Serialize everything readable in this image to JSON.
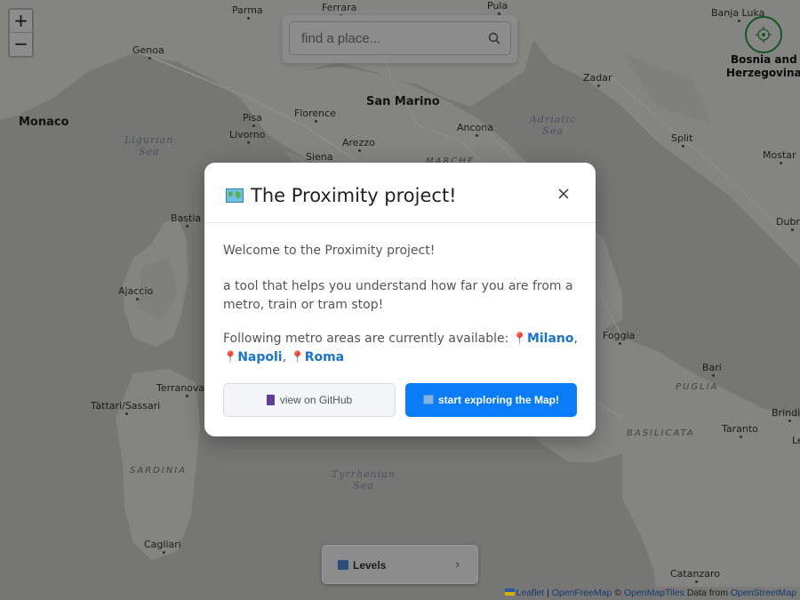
{
  "map": {
    "cities": [
      {
        "id": "parma",
        "label": "Parma"
      },
      {
        "id": "ferrara",
        "label": "Ferrara"
      },
      {
        "id": "pula",
        "label": "Pula"
      },
      {
        "id": "banja-luka",
        "label": "Banja Luka"
      },
      {
        "id": "genoa",
        "label": "Genoa"
      },
      {
        "id": "zadar",
        "label": "Zadar"
      },
      {
        "id": "monaco",
        "label": "Monaco"
      },
      {
        "id": "san-marino",
        "label": "San Marino"
      },
      {
        "id": "pisa",
        "label": "Pisa"
      },
      {
        "id": "florence",
        "label": "Florence"
      },
      {
        "id": "livorno",
        "label": "Livorno"
      },
      {
        "id": "ancona",
        "label": "Ancona"
      },
      {
        "id": "arezzo",
        "label": "Arezzo"
      },
      {
        "id": "split",
        "label": "Split"
      },
      {
        "id": "siena",
        "label": "Siena"
      },
      {
        "id": "mostar",
        "label": "Mostar"
      },
      {
        "id": "bastia",
        "label": "Bastia"
      },
      {
        "id": "dubrovnik",
        "label": "Dubro"
      },
      {
        "id": "ajaccio",
        "label": "Ajaccio"
      },
      {
        "id": "foggia",
        "label": "Foggia"
      },
      {
        "id": "bari",
        "label": "Bari"
      },
      {
        "id": "terranova",
        "label": "Terranova/O"
      },
      {
        "id": "tattari",
        "label": "Tàttari/Sassari"
      },
      {
        "id": "brindisi",
        "label": "Brindis"
      },
      {
        "id": "taranto",
        "label": "Taranto"
      },
      {
        "id": "lecce",
        "label": "Le"
      },
      {
        "id": "cagliari",
        "label": "Cagliari"
      },
      {
        "id": "catanzaro",
        "label": "Catanzaro"
      }
    ],
    "country_label": "Bosnia and\nHerzegovina",
    "seas": [
      {
        "id": "ligurian",
        "label": "Ligurian\nSea"
      },
      {
        "id": "adriatic",
        "label": "Adriatic\nSea"
      },
      {
        "id": "tyrrhenian",
        "label": "Tyrrhenian\nSea"
      }
    ],
    "regions": [
      {
        "id": "marche",
        "label": "MARCHE"
      },
      {
        "id": "puglia",
        "label": "PUGLIA"
      },
      {
        "id": "basilicata",
        "label": "BASILICATA"
      },
      {
        "id": "sardinia",
        "label": "SARDINIA"
      }
    ]
  },
  "controls": {
    "zoom_in": "+",
    "zoom_out": "−",
    "search_placeholder": "find a place...",
    "levels_label": "Levels",
    "levels_chevron": "›"
  },
  "modal": {
    "title": "The Proximity project!",
    "paragraph1": "Welcome to the Proximity project!",
    "paragraph2": "a tool that helps you understand how far you are from a metro, train or tram stop!",
    "paragraph3_prefix": "Following metro areas are currently available:",
    "cities": [
      "Milano",
      "Napoli",
      "Roma"
    ],
    "separator": ",",
    "pin_glyph": "📍",
    "github_button": "view on GitHub",
    "explore_button": "start exploring the Map!"
  },
  "attribution": {
    "leaflet": "Leaflet",
    "sep1": " | ",
    "openfreemap": "OpenFreeMap",
    "copyright": " © ",
    "openmaptiles": "OpenMapTiles",
    "data_from": " Data from ",
    "openstreetmap": "OpenStreetMap"
  },
  "colors": {
    "overlay": "rgba(0,0,0,0.45)",
    "accent": "#0b7cf7",
    "city_link": "#1a73d4",
    "locate_ring": "#2e9a41"
  }
}
